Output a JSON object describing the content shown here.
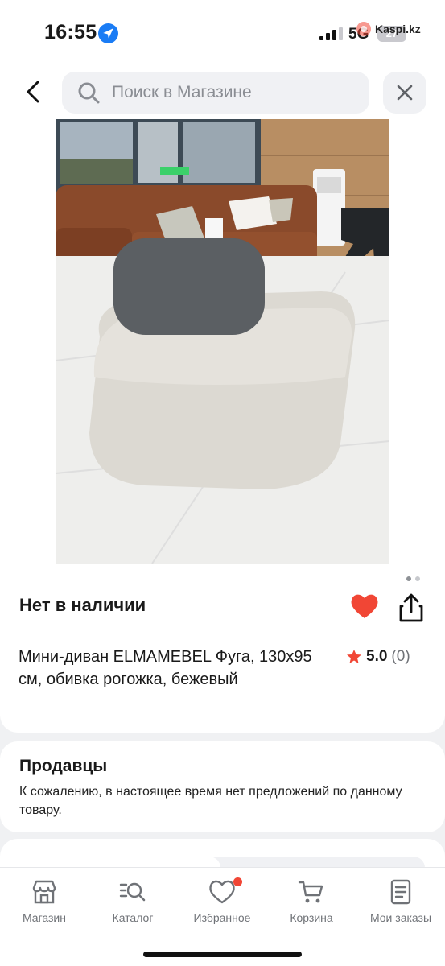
{
  "status_bar": {
    "time": "16:55",
    "network": "5G",
    "battery": "27",
    "watermark": "Kaspi.kz"
  },
  "header": {
    "search_placeholder": "Поиск в Магазине",
    "icons": [
      "back-arrow-icon",
      "search-icon",
      "close-icon"
    ]
  },
  "product": {
    "availability": "Нет в наличии",
    "title": "Мини-диван ELMAMEBEL Фуга, 130x95 см, обивка рогожка, бежевый",
    "rating": "5.0",
    "reviews": "(0)",
    "favorite": true,
    "image_page": 1,
    "image_count": 2
  },
  "sellers": {
    "title": "Продавцы",
    "text": "К сожалению, в настоящее время нет предложений по данному товару."
  },
  "nav": {
    "items": [
      {
        "label": "Магазин",
        "icon": "shop-icon"
      },
      {
        "label": "Каталог",
        "icon": "catalog-icon"
      },
      {
        "label": "Избранное",
        "icon": "heart-icon"
      },
      {
        "label": "Корзина",
        "icon": "cart-icon"
      },
      {
        "label": "Мои заказы",
        "icon": "orders-icon"
      }
    ]
  },
  "colors": {
    "accent_red": "#f14635",
    "ios_blue": "#1a7cf5",
    "background": "#f0f1f3"
  }
}
